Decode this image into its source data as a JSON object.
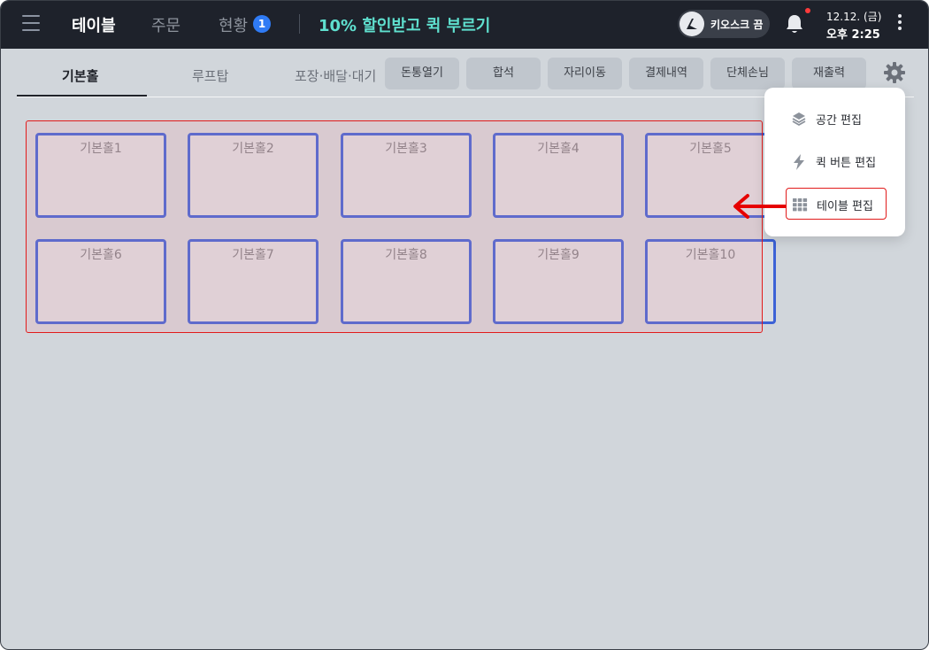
{
  "topbar": {
    "nav": {
      "table": "테이블",
      "order": "주문",
      "status": "현황"
    },
    "status_badge": "1",
    "promo": "10% 할인받고 퀵 부르기",
    "kiosk_label": "키오스크 끔",
    "date": "12.12. (금)",
    "time": "오후 2:25"
  },
  "zones": {
    "basic": "기본홀",
    "rooftop": "루프탑",
    "takeout": "포장·배달·대기"
  },
  "actions": [
    "돈통열기",
    "합석",
    "자리이동",
    "결제내역",
    "단체손님",
    "재출력"
  ],
  "tables": [
    "기본홀1",
    "기본홀2",
    "기본홀3",
    "기본홀4",
    "기본홀5",
    "기본홀6",
    "기본홀7",
    "기본홀8",
    "기본홀9",
    "기본홀10"
  ],
  "settings_menu": {
    "space_edit": "공간 편집",
    "quick_edit": "퀵 버튼 편집",
    "table_edit": "테이블 편집"
  },
  "colors": {
    "accent": "#2f7bf5",
    "promo": "#5fe0cf",
    "card_border": "#3c62d6",
    "highlight": "#e11b1b"
  }
}
